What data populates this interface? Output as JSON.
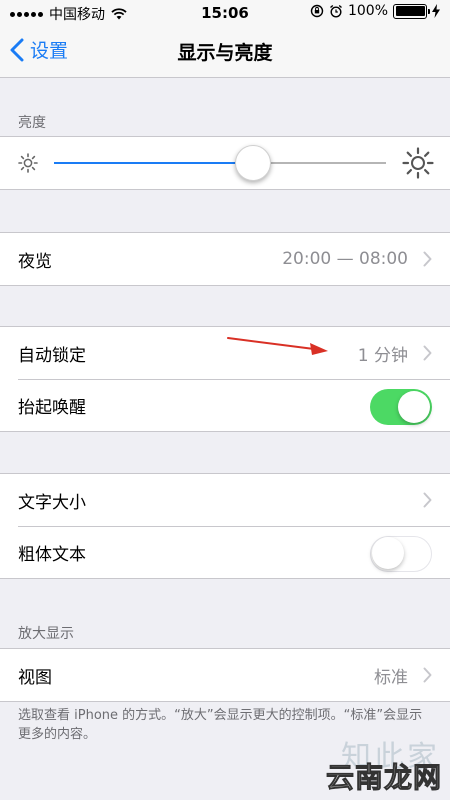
{
  "status_bar": {
    "carrier": "中国移动",
    "time": "15:06",
    "battery": "100%",
    "battery_level": 1.0
  },
  "nav": {
    "back_label": "设置",
    "title": "显示与亮度"
  },
  "brightness": {
    "header": "亮度",
    "level": 0.6
  },
  "night_shift": {
    "label": "夜览",
    "value": "20:00 — 08:00"
  },
  "auto_lock": {
    "label": "自动锁定",
    "value": "1 分钟"
  },
  "raise_to_wake": {
    "label": "抬起唤醒",
    "on": true
  },
  "text_size": {
    "label": "文字大小"
  },
  "bold_text": {
    "label": "粗体文本",
    "on": false
  },
  "display_zoom": {
    "header": "放大显示",
    "label": "视图",
    "value": "标准",
    "footer": "选取查看 iPhone 的方式。“放大”会显示更大的控制项。“标准”会显示更多的内容。"
  },
  "watermarks": {
    "line1": "知此家",
    "line2": "云南龙网"
  },
  "colors": {
    "accent": "#1a7cf5",
    "toggle_on": "#4cd964",
    "annotation_arrow": "#d93025"
  },
  "icons": {
    "back": "chevron-left-icon",
    "row": "chevron-right-icon",
    "brightness_low": "sun-small-icon",
    "brightness_high": "sun-large-icon"
  }
}
